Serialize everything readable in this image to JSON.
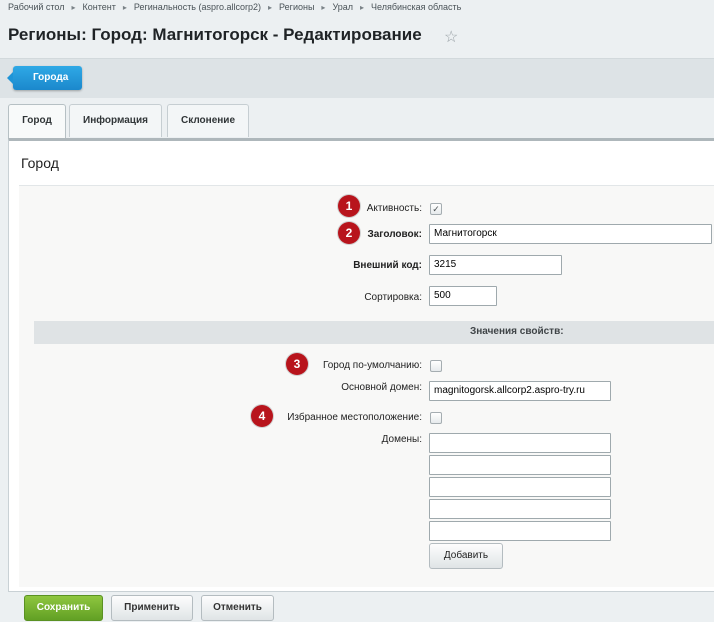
{
  "breadcrumbs": [
    "Рабочий стол",
    "Контент",
    "Регинальность (aspro.allcorp2)",
    "Регионы",
    "Урал",
    "Челябинская область"
  ],
  "page_title": "Регионы: Город: Магнитогорск - Редактирование",
  "toolbar": {
    "back_label": "Города"
  },
  "tabs": [
    "Город",
    "Информация",
    "Склонение"
  ],
  "panel_title": "Город",
  "fields": {
    "active_label": "Активность:",
    "active_checked": true,
    "title_label": "Заголовок:",
    "title_value": "Магнитогорск",
    "external_code_label": "Внешний код:",
    "external_code_value": "3215",
    "sort_label": "Сортировка:",
    "sort_value": "500"
  },
  "section_title": "Значения свойств:",
  "props": {
    "default_city_label": "Город по-умолчанию:",
    "default_city_checked": false,
    "main_domain_label": "Основной домен:",
    "main_domain_value": "magnitogorsk.allcorp2.aspro-try.ru",
    "favorite_label": "Избранное местоположение:",
    "favorite_checked": false,
    "domains_label": "Домены:",
    "domains_values": [
      "",
      "",
      "",
      "",
      ""
    ],
    "add_label": "Добавить"
  },
  "badges": [
    "1",
    "2",
    "3",
    "4"
  ],
  "footer": {
    "save": "Сохранить",
    "apply": "Применить",
    "cancel": "Отменить"
  },
  "colors": {
    "badge": "#b8141c",
    "save": "#6aa82a",
    "back_button": "#1f8fd3"
  }
}
